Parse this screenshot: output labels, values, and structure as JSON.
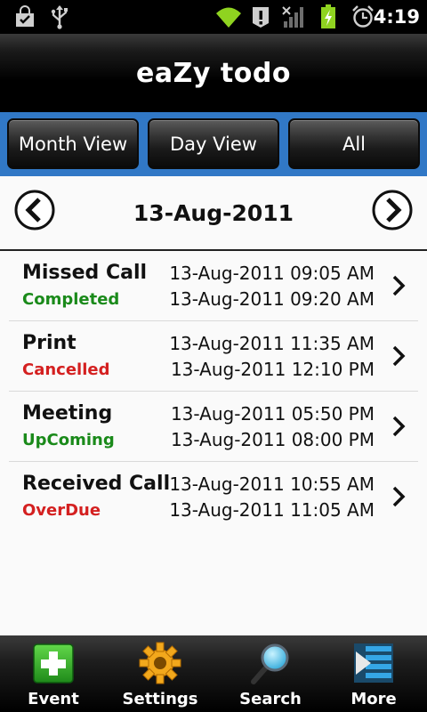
{
  "status_bar": {
    "time": "4:19",
    "icons": [
      "bag-icon",
      "usb-icon",
      "wifi-icon",
      "alert-icon",
      "signal-icon",
      "battery-icon",
      "alarm-icon"
    ]
  },
  "app": {
    "title": "eaZy todo"
  },
  "tabs": [
    {
      "label": "Month View"
    },
    {
      "label": "Day View"
    },
    {
      "label": "All"
    }
  ],
  "date_nav": {
    "current_date": "13-Aug-2011"
  },
  "tasks": [
    {
      "name": "Missed Call",
      "status": "Completed",
      "status_color": "#1a8a1a",
      "start": "13-Aug-2011 09:05 AM",
      "end": "13-Aug-2011 09:20 AM"
    },
    {
      "name": "Print",
      "status": "Cancelled",
      "status_color": "#d42020",
      "start": "13-Aug-2011 11:35 AM",
      "end": "13-Aug-2011 12:10 PM"
    },
    {
      "name": "Meeting",
      "status": "UpComing",
      "status_color": "#1a8a1a",
      "start": "13-Aug-2011 05:50 PM",
      "end": "13-Aug-2011 08:00 PM"
    },
    {
      "name": "Received Call",
      "status": "OverDue",
      "status_color": "#d42020",
      "start": "13-Aug-2011 10:55 AM",
      "end": "13-Aug-2011 11:05 AM"
    }
  ],
  "bottom_bar": [
    {
      "label": "Event",
      "icon": "add-event-icon"
    },
    {
      "label": "Settings",
      "icon": "gear-icon"
    },
    {
      "label": "Search",
      "icon": "magnifier-icon"
    },
    {
      "label": "More",
      "icon": "more-icon"
    }
  ],
  "colors": {
    "tab_strip": "#3178c6",
    "completed": "#1a8a1a",
    "cancelled": "#d42020"
  }
}
